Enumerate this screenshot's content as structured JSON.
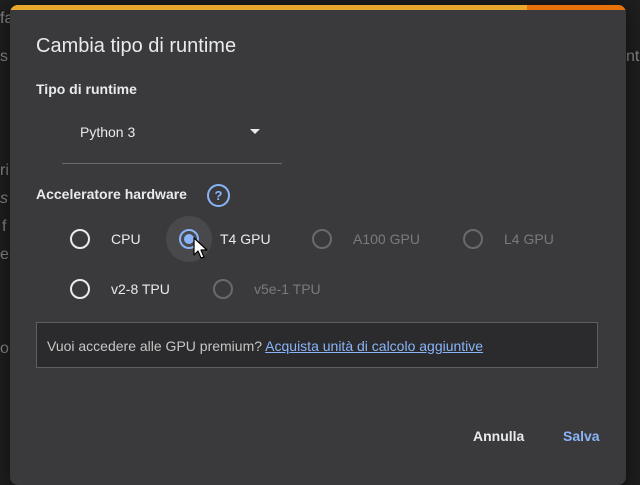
{
  "background_fragments": [
    "fa",
    "s",
    "nt",
    "ri",
    "s",
    "f",
    "e",
    "o,"
  ],
  "dialog": {
    "title": "Cambia tipo di runtime",
    "runtime_section_label": "Tipo di runtime",
    "runtime_select_value": "Python 3",
    "hardware_section_label": "Acceleratore hardware",
    "help_icon_glyph": "?",
    "accelerators": [
      {
        "label": "CPU",
        "selected": false,
        "enabled": true
      },
      {
        "label": "T4 GPU",
        "selected": true,
        "enabled": true
      },
      {
        "label": "A100 GPU",
        "selected": false,
        "enabled": false
      },
      {
        "label": "L4 GPU",
        "selected": false,
        "enabled": false
      },
      {
        "label": "v2-8 TPU",
        "selected": false,
        "enabled": true
      },
      {
        "label": "v5e-1 TPU",
        "selected": false,
        "enabled": false
      }
    ],
    "premium_prompt": "Vuoi accedere alle GPU premium? ",
    "premium_link": "Acquista unità di calcolo aggiuntive",
    "cancel_label": "Annulla",
    "save_label": "Salva"
  },
  "colors": {
    "accent": "#8ab4f8",
    "dialog_bg": "#3a3a3c",
    "progress": "#f29900"
  }
}
